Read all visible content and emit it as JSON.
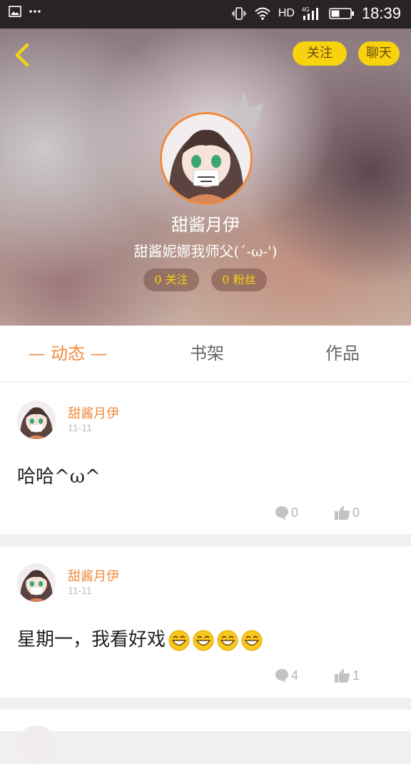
{
  "status_bar": {
    "network": "HD",
    "network_gen": "4G",
    "time": "18:39"
  },
  "header": {
    "follow_button": "关注",
    "chat_button": "聊天",
    "username": "甜酱月伊",
    "signature": "甜酱妮娜我师父(´-ω-')",
    "stats": {
      "following": "0 关注",
      "fans": "0 粉丝"
    }
  },
  "tabs": {
    "active": "— 动态 —",
    "shelf": "书架",
    "works": "作品"
  },
  "posts": [
    {
      "author": "甜酱月伊",
      "date": "11-11",
      "text": "哈哈^ω^",
      "emoji_count": 0,
      "comments": "0",
      "likes": "0"
    },
    {
      "author": "甜酱月伊",
      "date": "11-11",
      "text": "星期一，我看好戏",
      "emoji_count": 4,
      "comments": "4",
      "likes": "1"
    }
  ],
  "colors": {
    "accent": "#f08a3c",
    "pill": "#f6d20f",
    "status_bar": "#2a2326"
  },
  "icons": [
    "image-icon",
    "more-icon",
    "vibrate-icon",
    "wifi-icon",
    "signal-icon",
    "battery-icon",
    "back-arrow-icon",
    "crown-icon",
    "comment-icon",
    "like-icon",
    "laugh-emoji-icon"
  ]
}
